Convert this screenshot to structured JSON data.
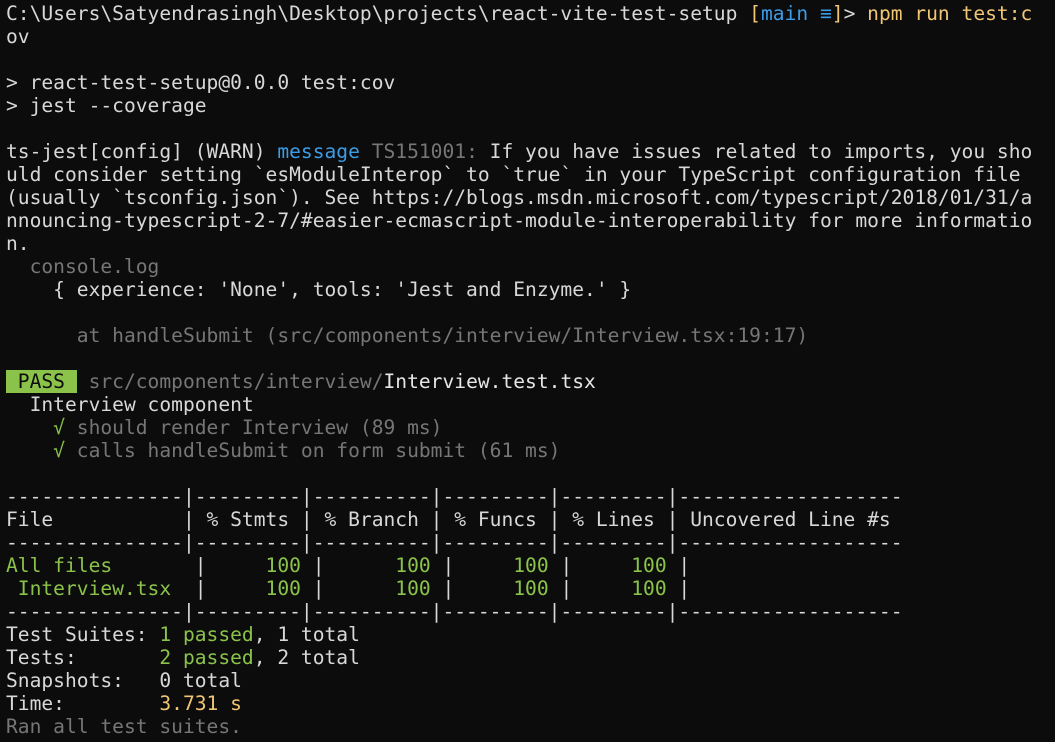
{
  "prompt": {
    "path": "C:\\Users\\Satyendrasingh\\Desktop\\projects\\react-vite-test-setup",
    "branch_open": " [",
    "branch": "main ≡",
    "branch_close": "]",
    "symbol": "> ",
    "command": "npm run test:c",
    "command_wrap": "ov"
  },
  "script_header": {
    "line1": "> react-test-setup@0.0.0 test:cov",
    "line2": "> jest --coverage"
  },
  "warning": {
    "prefix": "ts-jest[config] (WARN) ",
    "label": "message",
    "code": " TS151001:",
    "text1": " If you have issues related to imports, you sho",
    "text2": "uld consider setting `esModuleInterop` to `true` in your TypeScript configuration file",
    "text3": "(usually `tsconfig.json`). See https://blogs.msdn.microsoft.com/typescript/2018/01/31/a",
    "text4": "nnouncing-typescript-2-7/#easier-ecmascript-module-interoperability for more informatio",
    "text5": "n."
  },
  "console": {
    "label": "  console.log",
    "output": "    { experience: 'None', tools: 'Jest and Enzyme.' }",
    "trace": "      at handleSubmit (src/components/interview/Interview.tsx:19:17)"
  },
  "result": {
    "badge": " PASS ",
    "dir": " src/components/interview/",
    "file": "Interview.test.tsx",
    "suite": "  Interview component",
    "tests": [
      {
        "check": "    √",
        "name": " should render Interview (89 ms)"
      },
      {
        "check": "    √",
        "name": " calls handleSubmit on form submit (61 ms)"
      }
    ]
  },
  "coverage": {
    "sep": "---------------|---------|----------|---------|---------|-------------------",
    "header": "File           | % Stmts | % Branch | % Funcs | % Lines | Uncovered Line #s",
    "rows": [
      {
        "name": "All files      ",
        "p1": " |     ",
        "stmts": "100",
        "p2": " |      ",
        "branch": "100",
        "p3": " |     ",
        "funcs": "100",
        "p4": " |     ",
        "lines": "100",
        "p5": " |"
      },
      {
        "name": " Interview.tsx ",
        "p1": " |     ",
        "stmts": "100",
        "p2": " |      ",
        "branch": "100",
        "p3": " |     ",
        "funcs": "100",
        "p4": " |     ",
        "lines": "100",
        "p5": " |"
      }
    ]
  },
  "summary": {
    "suites_label": "Test Suites: ",
    "suites_passed": "1 passed",
    "suites_total": ", 1 total",
    "tests_label": "Tests:       ",
    "tests_passed": "2 passed",
    "tests_total": ", 2 total",
    "snapshots_label": "Snapshots:   ",
    "snapshots_value": "0 total",
    "time_label": "Time:        ",
    "time_value": "3.731 s",
    "ran": "Ran all test suites."
  },
  "colors": {
    "background": "#0c0c0c",
    "pass": "#8bc34a",
    "path_yellow": "#f0c674",
    "message_blue": "#3b9de8",
    "dim": "#767676"
  }
}
